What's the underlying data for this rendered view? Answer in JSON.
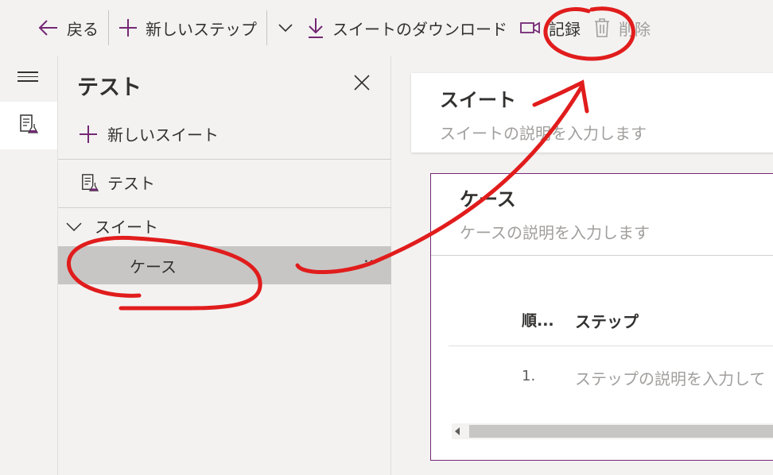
{
  "toolbar": {
    "back_label": "戻る",
    "new_step_label": "新しいステップ",
    "download_label": "スイートのダウンロード",
    "record_label": "記録",
    "delete_label": "削除"
  },
  "panel": {
    "title": "テスト",
    "new_suite_label": "新しいスイート",
    "test_item_label": "テスト",
    "suite_label": "スイート",
    "case_label": "ケース",
    "more_label": "⋯"
  },
  "suite": {
    "title": "スイート",
    "description_placeholder": "スイートの説明を入力します"
  },
  "case": {
    "title": "ケース",
    "description_placeholder": "ケースの説明を入力します",
    "columns": [
      "順...",
      "ステップ"
    ],
    "rows": [
      {
        "order": "1.",
        "step_placeholder": "ステップの説明を入力して"
      }
    ]
  },
  "colors": {
    "accent": "#742774",
    "annotation": "#e11c1c",
    "selected_row": "#c8c6c4"
  },
  "icons": {
    "back": "arrow-left-icon",
    "new_step": "plus-icon",
    "chevron": "chevron-down-icon",
    "download": "download-icon",
    "record": "video-camera-icon",
    "delete": "trash-icon",
    "menu": "hamburger-icon",
    "test": "test-flask-icon",
    "close": "close-icon"
  }
}
